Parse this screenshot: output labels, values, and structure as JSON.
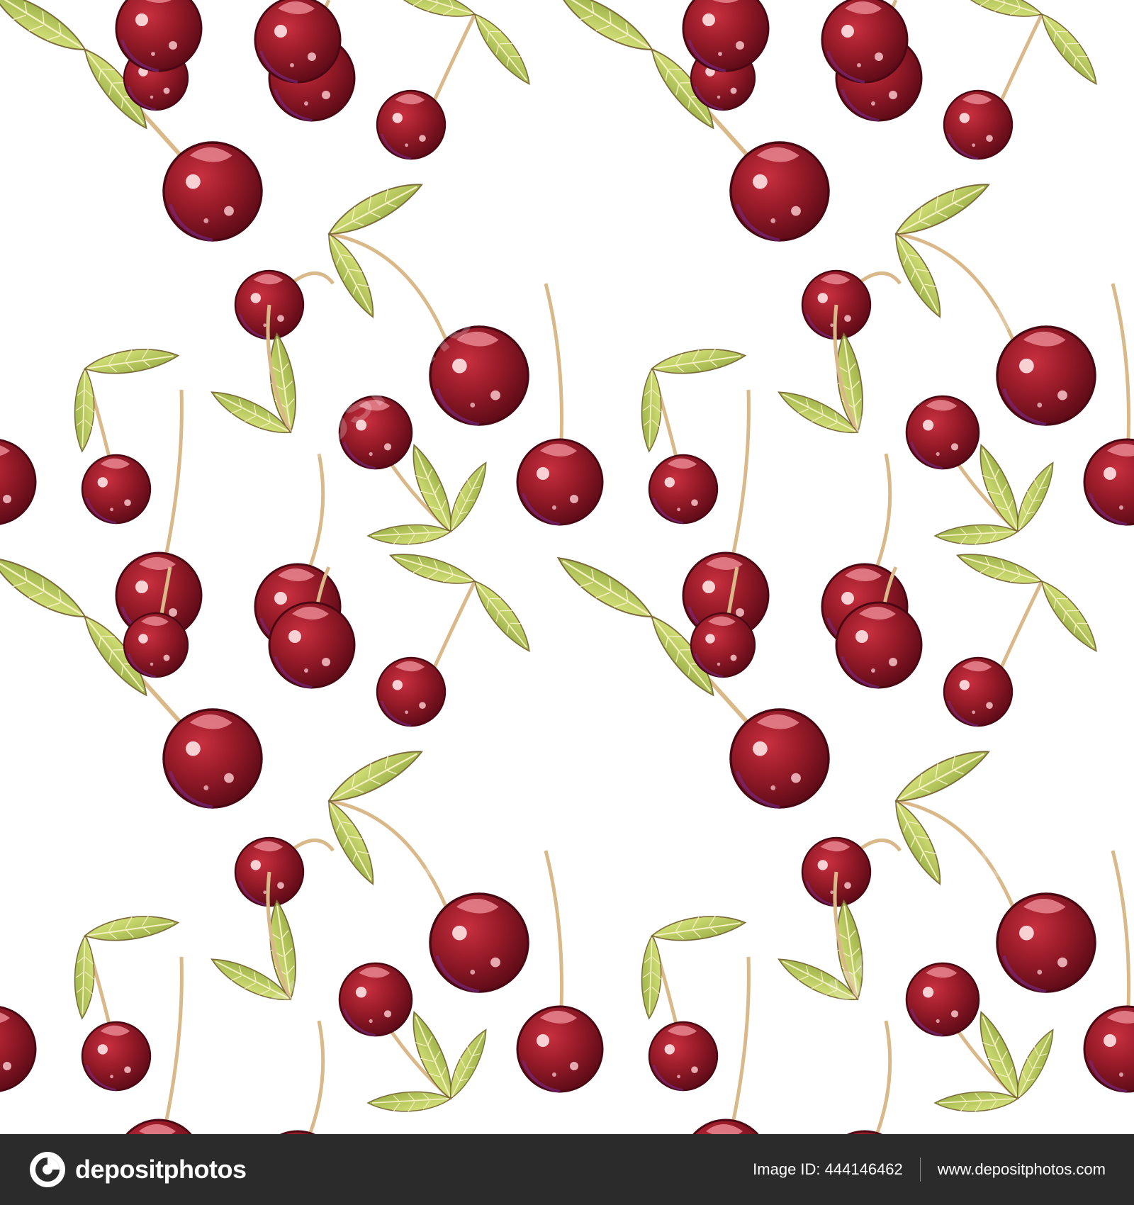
{
  "footer": {
    "brand_name": "depositphotos",
    "image_id_text": "Image ID: 444146462",
    "site_url": "www.depositphotos.com"
  },
  "artwork": {
    "subject": "seamless cherry pattern",
    "colors": {
      "background": "#ffffff",
      "cherry_dark": "#6e0f1b",
      "cherry_mid": "#9b1c2a",
      "cherry_highlight": "#f2a3a8",
      "leaf": "#c7d96a",
      "leaf_dark": "#8fa63d",
      "stem": "#d9b98a",
      "footer_bg": "#2b2b2b"
    },
    "watermark": "depositphotos"
  }
}
